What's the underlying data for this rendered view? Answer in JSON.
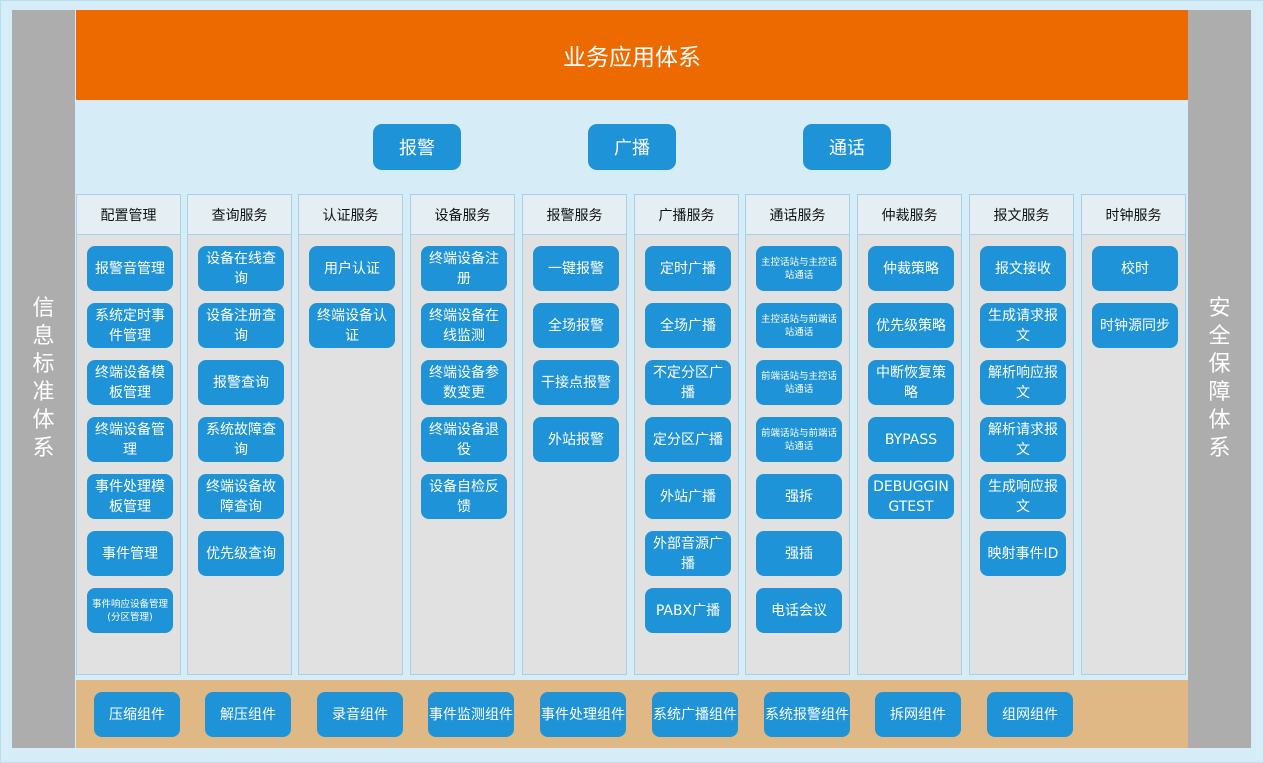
{
  "header": {
    "title": "业务应用体系"
  },
  "left_label": "信息标准体系",
  "right_label": "安全保障体系",
  "top_buttons": [
    "报警",
    "广播",
    "通话"
  ],
  "columns": [
    {
      "title": "配置管理",
      "items": [
        "报警音管理",
        "系统定时事件管理",
        "终端设备模板管理",
        "终端设备管理",
        "事件处理模板管理",
        "事件管理",
        "事件响应设备管理(分区管理)"
      ]
    },
    {
      "title": "查询服务",
      "items": [
        "设备在线查询",
        "设备注册查询",
        "报警查询",
        "系统故障查询",
        "终端设备故障查询",
        "优先级查询"
      ]
    },
    {
      "title": "认证服务",
      "items": [
        "用户认证",
        "终端设备认证"
      ]
    },
    {
      "title": "设备服务",
      "items": [
        "终端设备注册",
        "终端设备在线监测",
        "终端设备参数变更",
        "终端设备退役",
        "设备自检反馈"
      ]
    },
    {
      "title": "报警服务",
      "items": [
        "一键报警",
        "全场报警",
        "干接点报警",
        "外站报警"
      ]
    },
    {
      "title": "广播服务",
      "items": [
        "定时广播",
        "全场广播",
        "不定分区广播",
        "定分区广播",
        "外站广播",
        "外部音源广播",
        "PABX广播"
      ]
    },
    {
      "title": "通话服务",
      "items": [
        "主控话站与主控话站通话",
        "主控话站与前端话站通话",
        "前端话站与主控话站通话",
        "前端话站与前端话站通话",
        "强拆",
        "强插",
        "电话会议"
      ]
    },
    {
      "title": "仲裁服务",
      "items": [
        "仲裁策略",
        "优先级策略",
        "中断恢复策略",
        "BYPASS",
        "DEBUGGINGTEST"
      ]
    },
    {
      "title": "报文服务",
      "items": [
        "报文接收",
        "生成请求报文",
        "解析响应报文",
        "解析请求报文",
        "生成响应报文",
        "映射事件ID"
      ]
    },
    {
      "title": "时钟服务",
      "items": [
        "校时",
        "时钟源同步"
      ]
    }
  ],
  "components": [
    "压缩组件",
    "解压组件",
    "录音组件",
    "事件监测组件",
    "事件处理组件",
    "系统广播组件",
    "系统报警组件",
    "拆网组件",
    "组网组件"
  ],
  "colors": {
    "header": "#ec6a00",
    "button": "#1e93d8",
    "band": "#d6ecf6",
    "column": "#e1e1e1",
    "component_band": "#dfb886",
    "side": "#adadad"
  }
}
